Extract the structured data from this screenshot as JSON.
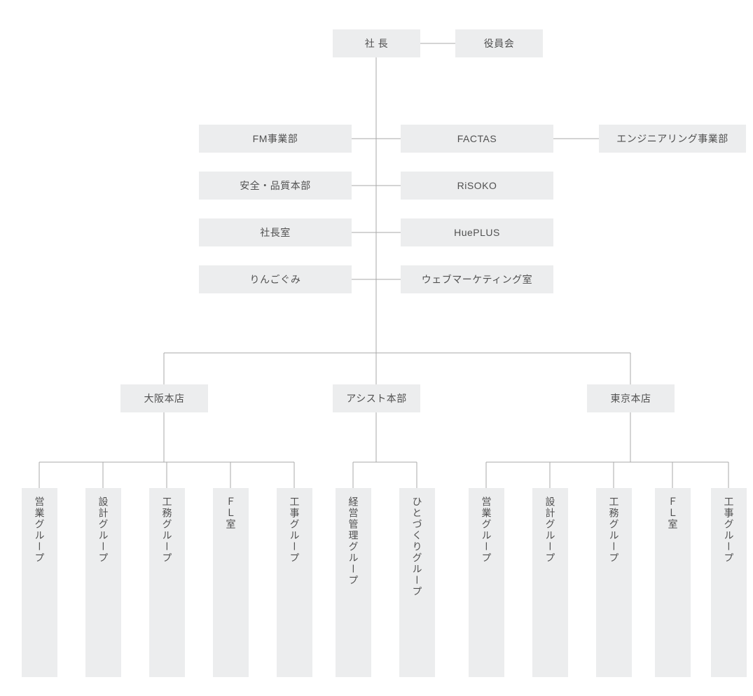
{
  "top": {
    "president": "社 長",
    "board": "役員会"
  },
  "mid_rows": [
    {
      "left": "FM事業部",
      "right": "FACTAS",
      "extra": "エンジニアリング事業部"
    },
    {
      "left": "安全・品質本部",
      "right": "RiSOKO"
    },
    {
      "left": "社長室",
      "right": "HuePLUS"
    },
    {
      "left": "りんごぐみ",
      "right": "ウェブマーケティング室"
    }
  ],
  "divisions": {
    "osaka": {
      "label": "大阪本店",
      "groups": [
        "営業グループ",
        "設計グループ",
        "工務グループ",
        "ＦＬ室",
        "工事グループ"
      ]
    },
    "assist": {
      "label": "アシスト本部",
      "groups": [
        "経営管理グループ",
        "ひとづくりグループ"
      ]
    },
    "tokyo": {
      "label": "東京本店",
      "groups": [
        "営業グループ",
        "設計グループ",
        "工務グループ",
        "ＦＬ室",
        "工事グループ"
      ]
    }
  },
  "colors": {
    "box_bg": "#ecedee",
    "line": "#a9a9a9",
    "text": "#505050"
  }
}
